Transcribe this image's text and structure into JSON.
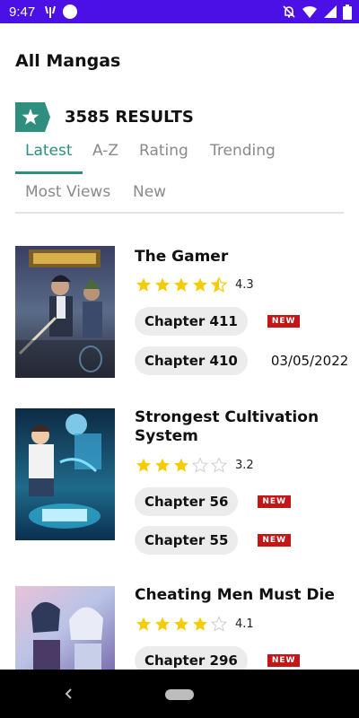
{
  "status_bar": {
    "time": "9:47",
    "background_color": "#4a10e6",
    "left_icons": [
      "signal-wifi-icon",
      "circle-icon"
    ],
    "right_icons": [
      "mute-bell-icon",
      "wifi-icon",
      "cellular-icon",
      "battery-icon"
    ]
  },
  "header": {
    "title": "All Mangas",
    "results": "3585 RESULTS"
  },
  "tabs": [
    {
      "label": "Latest",
      "active": true
    },
    {
      "label": "A-Z",
      "active": false
    },
    {
      "label": "Rating",
      "active": false
    },
    {
      "label": "Trending",
      "active": false
    },
    {
      "label": "Most Views",
      "active": false
    },
    {
      "label": "New",
      "active": false
    }
  ],
  "accent_color": "#2f8f7e",
  "mangas": [
    {
      "title": "The Gamer",
      "rating": "4.3",
      "stars": 4.5,
      "chapters": [
        {
          "label": "Chapter 411",
          "badge": "NEW",
          "date": ""
        },
        {
          "label": "Chapter 410",
          "badge": "",
          "date": "03/05/2022"
        }
      ]
    },
    {
      "title": "Strongest Cultivation System",
      "rating": "3.2",
      "stars": 3,
      "chapters": [
        {
          "label": "Chapter 56",
          "badge": "NEW",
          "date": ""
        },
        {
          "label": "Chapter 55",
          "badge": "NEW",
          "date": ""
        }
      ]
    },
    {
      "title": "Cheating Men Must Die",
      "rating": "4.1",
      "stars": 4,
      "chapters": [
        {
          "label": "Chapter 296",
          "badge": "NEW",
          "date": ""
        }
      ]
    }
  ]
}
